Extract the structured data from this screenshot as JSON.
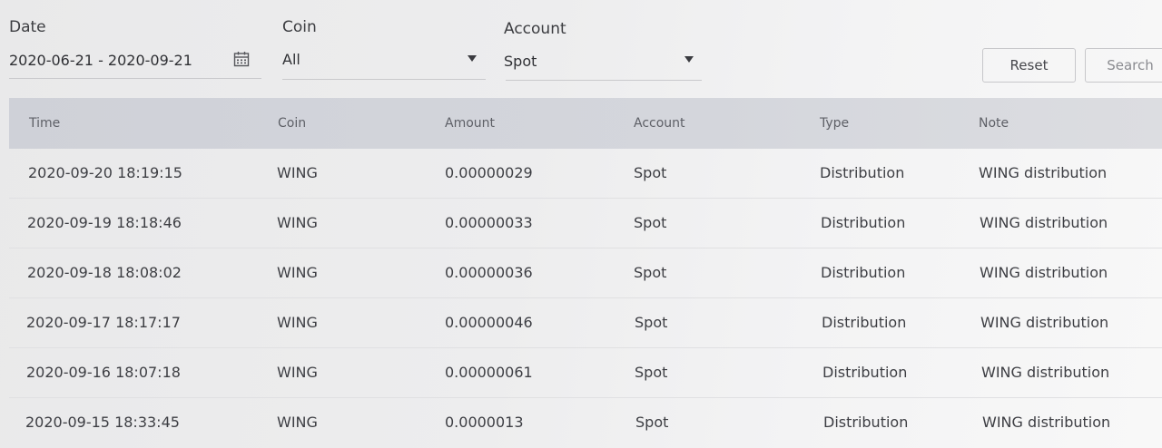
{
  "filters": {
    "date": {
      "label": "Date",
      "value": "2020-06-21 - 2020-09-21",
      "icon": "calendar-icon"
    },
    "coin": {
      "label": "Coin",
      "value": "All",
      "icon": "caret-down-icon"
    },
    "account": {
      "label": "Account",
      "value": "Spot",
      "icon": "caret-down-icon"
    },
    "reset_label": "Reset",
    "search_label": "Search"
  },
  "table": {
    "headers": [
      "Time",
      "Coin",
      "Amount",
      "Account",
      "Type",
      "Note"
    ],
    "rows": [
      [
        "2020-09-20 18:19:15",
        "WING",
        "0.00000029",
        "Spot",
        "Distribution",
        "WING distribution"
      ],
      [
        "2020-09-19 18:18:46",
        "WING",
        "0.00000033",
        "Spot",
        "Distribution",
        "WING distribution"
      ],
      [
        "2020-09-18 18:08:02",
        "WING",
        "0.00000036",
        "Spot",
        "Distribution",
        "WING distribution"
      ],
      [
        "2020-09-17 18:17:17",
        "WING",
        "0.00000046",
        "Spot",
        "Distribution",
        "WING distribution"
      ],
      [
        "2020-09-16 18:07:18",
        "WING",
        "0.00000061",
        "Spot",
        "Distribution",
        "WING distribution"
      ],
      [
        "2020-09-15 18:33:45",
        "WING",
        "0.0000013",
        "Spot",
        "Distribution",
        "WING distribution"
      ]
    ]
  }
}
